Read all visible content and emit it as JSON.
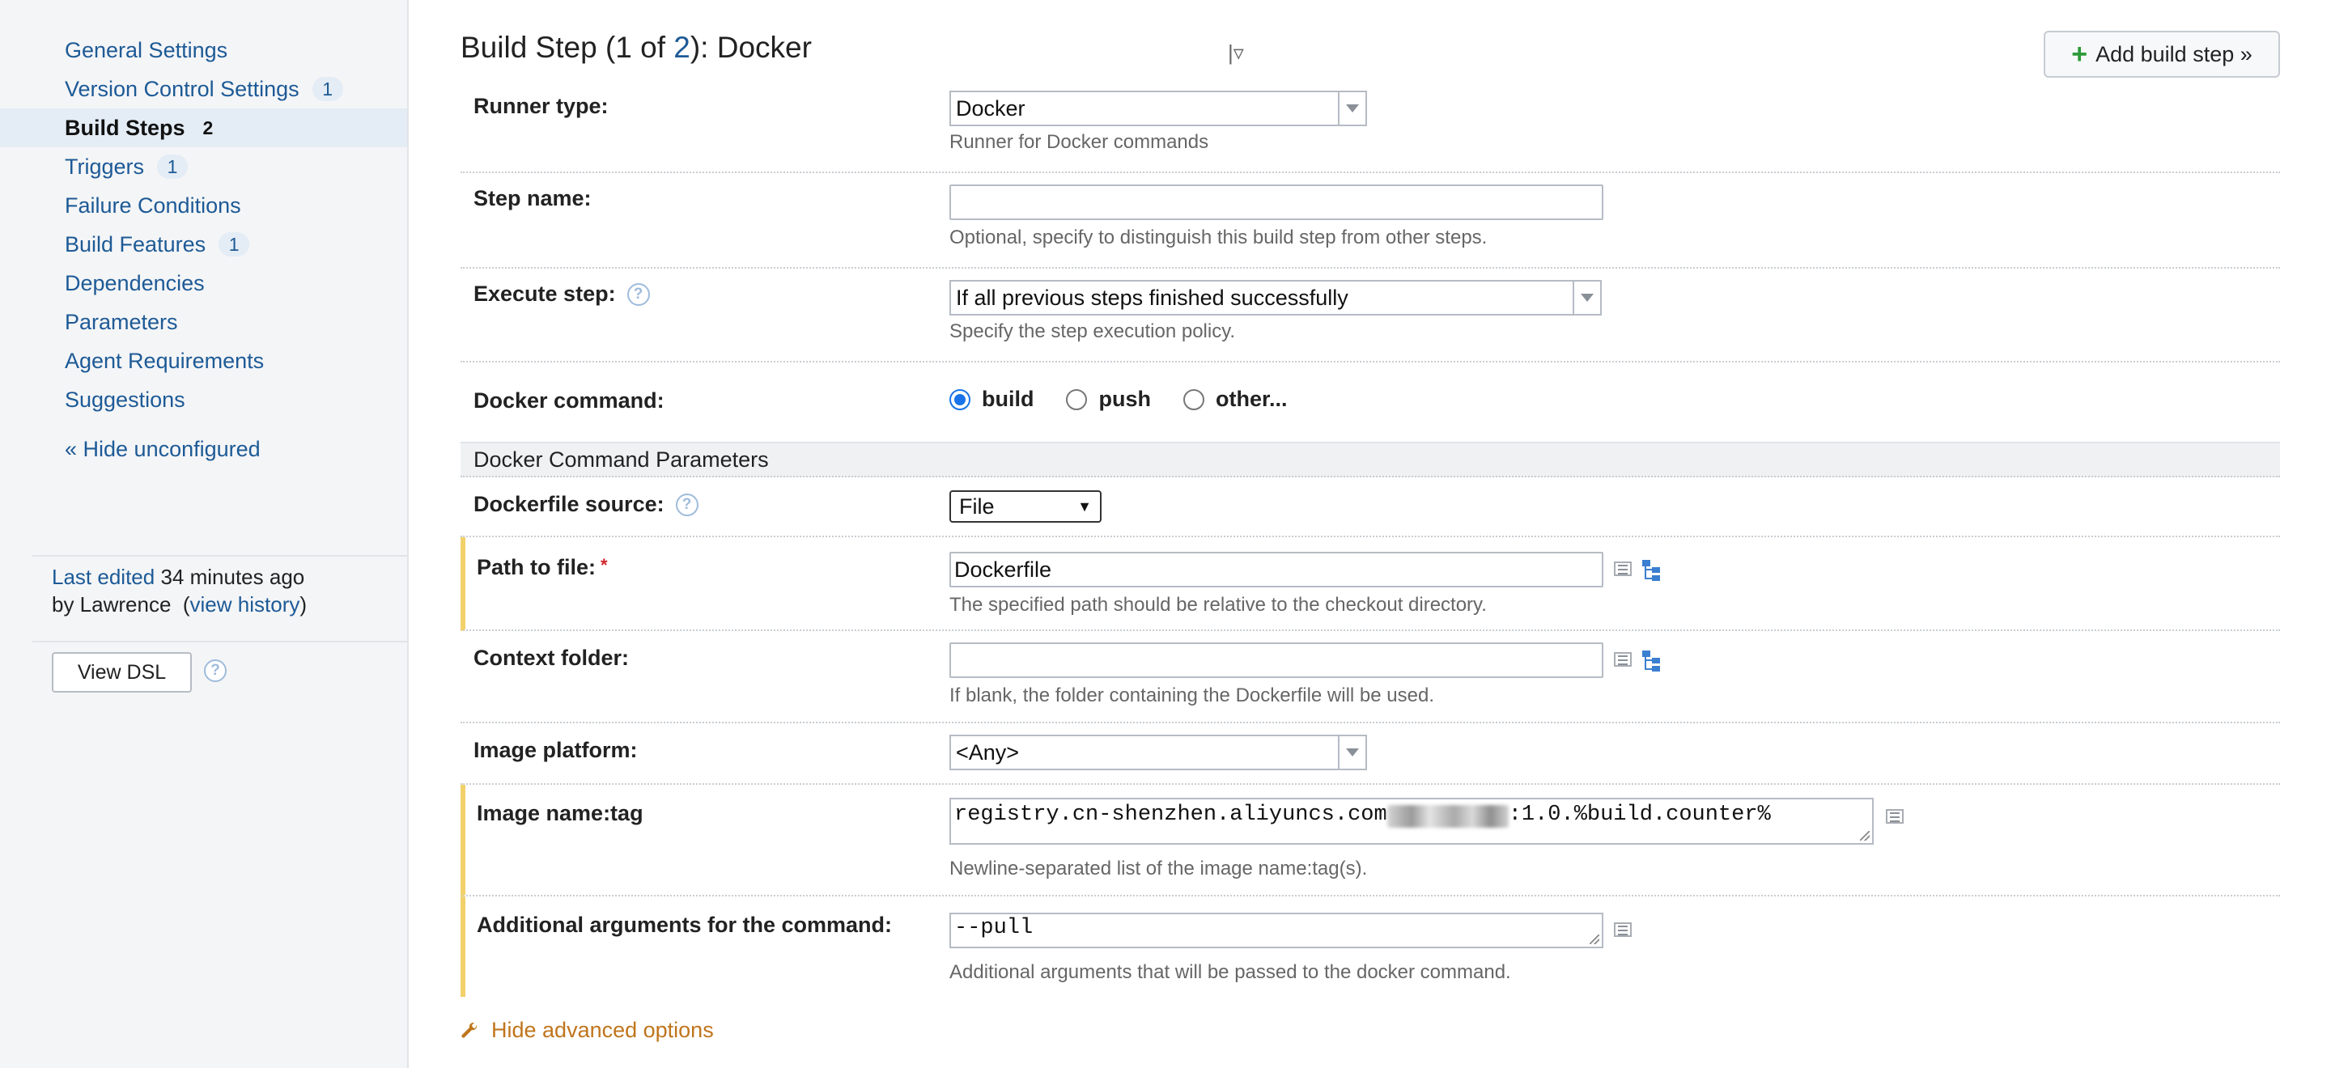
{
  "sidebar": {
    "items": [
      {
        "label": "General Settings",
        "count": ""
      },
      {
        "label": "Version Control Settings",
        "count": "1"
      },
      {
        "label": "Build Steps",
        "count": "2"
      },
      {
        "label": "Triggers",
        "count": "1"
      },
      {
        "label": "Failure Conditions",
        "count": ""
      },
      {
        "label": "Build Features",
        "count": "1"
      },
      {
        "label": "Dependencies",
        "count": ""
      },
      {
        "label": "Parameters",
        "count": ""
      },
      {
        "label": "Agent Requirements",
        "count": ""
      },
      {
        "label": "Suggestions",
        "count": ""
      }
    ],
    "active_index": 2,
    "hide_unconfigured": "« Hide unconfigured",
    "last_edited_link": "Last edited",
    "last_edited_time": "34 minutes ago",
    "last_edited_by": "by Lawrence",
    "view_history": "view history",
    "view_dsl": "View DSL"
  },
  "header": {
    "title_prefix": "Build Step (1 of ",
    "total_steps": "2",
    "title_suffix": "): Docker",
    "add_step_label": "Add build step »"
  },
  "form": {
    "runner_type": {
      "label": "Runner type:",
      "value": "Docker",
      "desc": "Runner for Docker commands"
    },
    "step_name": {
      "label": "Step name:",
      "value": "",
      "desc": "Optional, specify to distinguish this build step from other steps."
    },
    "execute_step": {
      "label": "Execute step:",
      "value": "If all previous steps finished successfully",
      "desc": "Specify the step execution policy."
    },
    "docker_command": {
      "label": "Docker command:",
      "options": [
        "build",
        "push",
        "other..."
      ],
      "selected": "build"
    },
    "section_title": "Docker Command Parameters",
    "dockerfile_source": {
      "label": "Dockerfile source:",
      "value": "File"
    },
    "path_to_file": {
      "label": "Path to file:",
      "required_mark": "*",
      "value": "Dockerfile",
      "desc": "The specified path should be relative to the checkout directory."
    },
    "context_folder": {
      "label": "Context folder:",
      "value": "",
      "desc": "If blank, the folder containing the Dockerfile will be used."
    },
    "image_platform": {
      "label": "Image platform:",
      "value": "<Any>"
    },
    "image_name_tag": {
      "label": "Image name:tag",
      "value_prefix": "registry.cn-shenzhen.aliyuncs.com",
      "value_suffix": ":1.0.%build.counter%",
      "desc": "Newline-separated list of the image name:tag(s)."
    },
    "additional_args": {
      "label": "Additional arguments for the command:",
      "value": "--pull",
      "desc": "Additional arguments that will be passed to the docker command."
    }
  },
  "footer": {
    "hide_advanced": "Hide advanced options"
  },
  "colors": {
    "link": "#1d5a96",
    "required_bar": "#f2d16b",
    "advanced_link": "#c0751c",
    "radio_checked": "#1a73e8"
  }
}
